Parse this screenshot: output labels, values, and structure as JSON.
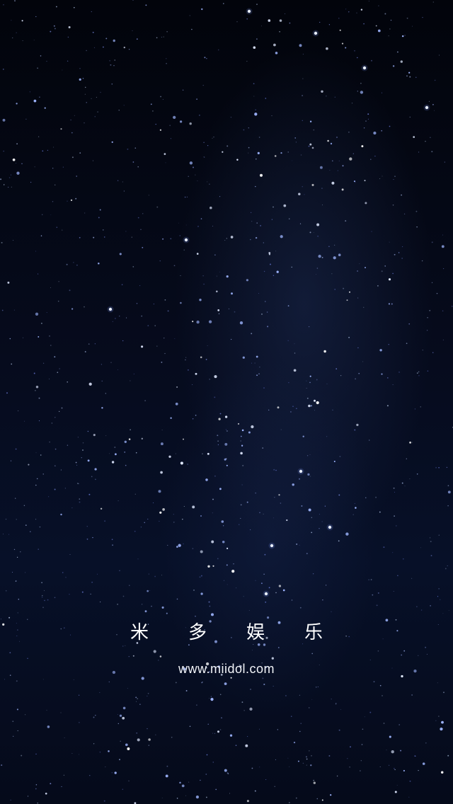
{
  "splash": {
    "title": "米多娱乐",
    "url": "www.miidol.com"
  },
  "background": {
    "type": "night-sky-starfield"
  }
}
